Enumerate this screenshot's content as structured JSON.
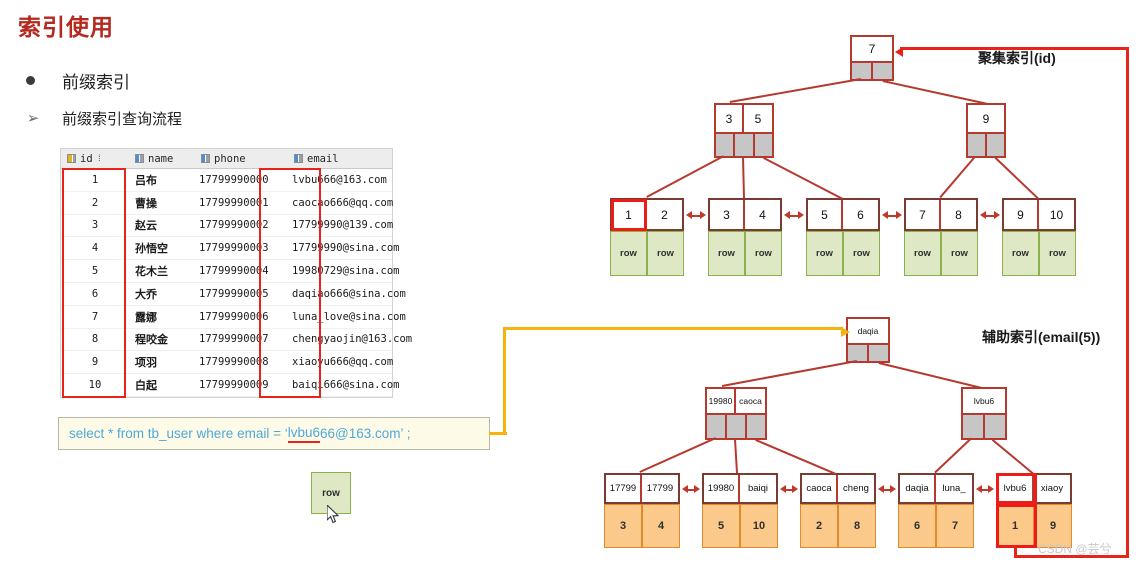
{
  "page_title": "索引使用",
  "bullets": [
    {
      "marker": "•",
      "text": "前缀索引"
    },
    {
      "marker": "➢",
      "text": "前缀索引查询流程"
    }
  ],
  "table": {
    "columns": [
      {
        "label": "id",
        "icon": "primary-key-icon",
        "sortable": true,
        "sort_caret": "⁞"
      },
      {
        "label": "name",
        "icon": "column-icon"
      },
      {
        "label": "phone",
        "icon": "column-icon"
      },
      {
        "label": "email",
        "icon": "column-icon"
      }
    ],
    "rows": [
      {
        "id": "1",
        "name": "吕布",
        "phone": "17799990000",
        "email": "lvbu666@163.com"
      },
      {
        "id": "2",
        "name": "曹操",
        "phone": "17799990001",
        "email": "caocao666@qq.com"
      },
      {
        "id": "3",
        "name": "赵云",
        "phone": "17799990002",
        "email": "17799990@139.com"
      },
      {
        "id": "4",
        "name": "孙悟空",
        "phone": "17799990003",
        "email": "17799990@sina.com"
      },
      {
        "id": "5",
        "name": "花木兰",
        "phone": "17799990004",
        "email": "19980729@sina.com"
      },
      {
        "id": "6",
        "name": "大乔",
        "phone": "17799990005",
        "email": "daqiao666@sina.com"
      },
      {
        "id": "7",
        "name": "露娜",
        "phone": "17799990006",
        "email": "luna_love@sina.com"
      },
      {
        "id": "8",
        "name": "程咬金",
        "phone": "17799990007",
        "email": "chengyaojin@163.com"
      },
      {
        "id": "9",
        "name": "项羽",
        "phone": "17799990008",
        "email": "xiaoyu666@qq.com"
      },
      {
        "id": "10",
        "name": "白起",
        "phone": "17799990009",
        "email": "baiqi666@sina.com"
      }
    ],
    "highlight_columns": [
      "id",
      "email"
    ]
  },
  "sql": {
    "prefix": "select * from tb_user where email = ‘",
    "underlined": "lvbu6",
    "rest": "66@163.com’ ;"
  },
  "result_row": {
    "label": "row"
  },
  "clustered_index": {
    "label": "聚集索引(id)",
    "root": {
      "keys": [
        "7"
      ],
      "pointers": 2
    },
    "level2": [
      {
        "keys": [
          "3",
          "5"
        ],
        "pointers": 3
      },
      {
        "keys": [
          "9"
        ],
        "pointers": 2
      }
    ],
    "leaves": [
      {
        "keys": [
          "1",
          "2"
        ],
        "data": [
          "row",
          "row"
        ]
      },
      {
        "keys": [
          "3",
          "4"
        ],
        "data": [
          "row",
          "row"
        ]
      },
      {
        "keys": [
          "5",
          "6"
        ],
        "data": [
          "row",
          "row"
        ]
      },
      {
        "keys": [
          "7",
          "8"
        ],
        "data": [
          "row",
          "row"
        ]
      },
      {
        "keys": [
          "9",
          "10"
        ],
        "data": [
          "row",
          "row"
        ]
      }
    ],
    "selected_key": "1"
  },
  "secondary_index": {
    "label": "辅助索引(email(5))",
    "root": {
      "keys": [
        "daqia"
      ],
      "pointers": 2
    },
    "level2": [
      {
        "keys": [
          "19980",
          "caoca"
        ],
        "pointers": 3
      },
      {
        "keys": [
          "lvbu6"
        ],
        "pointers": 2
      }
    ],
    "leaves": [
      {
        "keys": [
          "17799",
          "17799"
        ],
        "data": [
          "3",
          "4"
        ]
      },
      {
        "keys": [
          "19980",
          "baiqi"
        ],
        "data": [
          "5",
          "10"
        ]
      },
      {
        "keys": [
          "caoca",
          "cheng"
        ],
        "data": [
          "2",
          "8"
        ]
      },
      {
        "keys": [
          "daqia",
          "luna_"
        ],
        "data": [
          "6",
          "7"
        ]
      },
      {
        "keys": [
          "lvbu6",
          "xiaoy"
        ],
        "data": [
          "1",
          "9"
        ]
      }
    ],
    "selected_key": "lvbu6",
    "selected_value": "1"
  },
  "colors": {
    "title": "#b42a1e",
    "node_border": "#b5392f",
    "highlight": "#e8231a",
    "yellow_path": "#f5b30b",
    "clustered_leaf": "#dfe8c4",
    "secondary_leaf": "#fbc98a",
    "sql_text": "#4fa8d8"
  },
  "watermark": "CSDN @芸兮"
}
